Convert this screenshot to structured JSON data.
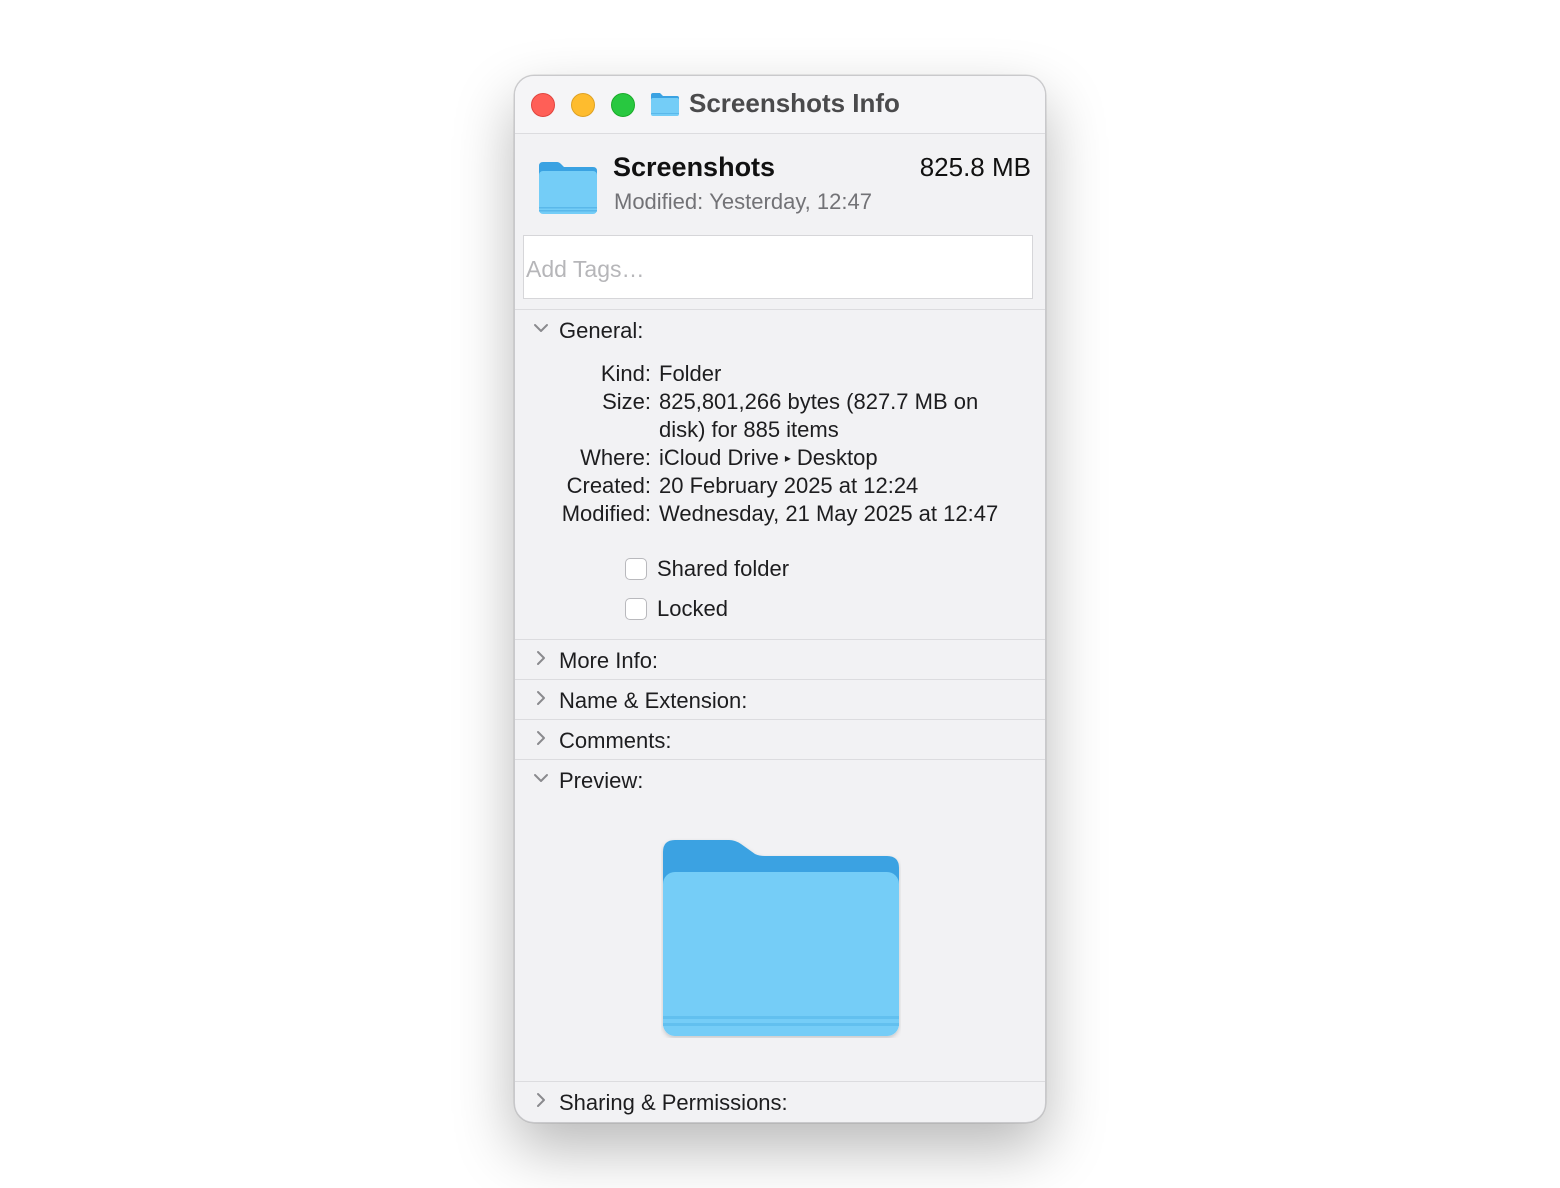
{
  "window": {
    "title": "Screenshots Info",
    "title_icon": "folder-icon"
  },
  "header": {
    "name": "Screenshots",
    "size": "825.8 MB",
    "modified_label": "Modified:",
    "modified_value": "Yesterday, 12:47",
    "icon": "folder-icon"
  },
  "tags": {
    "placeholder": "Add Tags…",
    "value": ""
  },
  "general": {
    "label": "General:",
    "expanded": true,
    "kind_label": "Kind:",
    "kind_value": "Folder",
    "size_label": "Size:",
    "size_value_line1": "825,801,266 bytes (827.7 MB on",
    "size_value_line2": "disk) for 885 items",
    "where_label": "Where:",
    "where_part1": "iCloud Drive",
    "where_arrow": "▸",
    "where_part2": "Desktop",
    "created_label": "Created:",
    "created_value": "20 February 2025 at 12:24",
    "modified_label": "Modified:",
    "modified_value": "Wednesday, 21 May 2025 at 12:47",
    "shared_folder_label": "Shared folder",
    "shared_folder_checked": false,
    "locked_label": "Locked",
    "locked_checked": false
  },
  "sections": {
    "more_info": "More Info:",
    "name_extension": "Name & Extension:",
    "comments": "Comments:",
    "preview": "Preview:",
    "sharing": "Sharing & Permissions:"
  },
  "colors": {
    "close": "#ff5f57",
    "minimize": "#febc2e",
    "maximize": "#28c840",
    "folder_front": "#74cdf7",
    "folder_back": "#3aa2e2"
  }
}
